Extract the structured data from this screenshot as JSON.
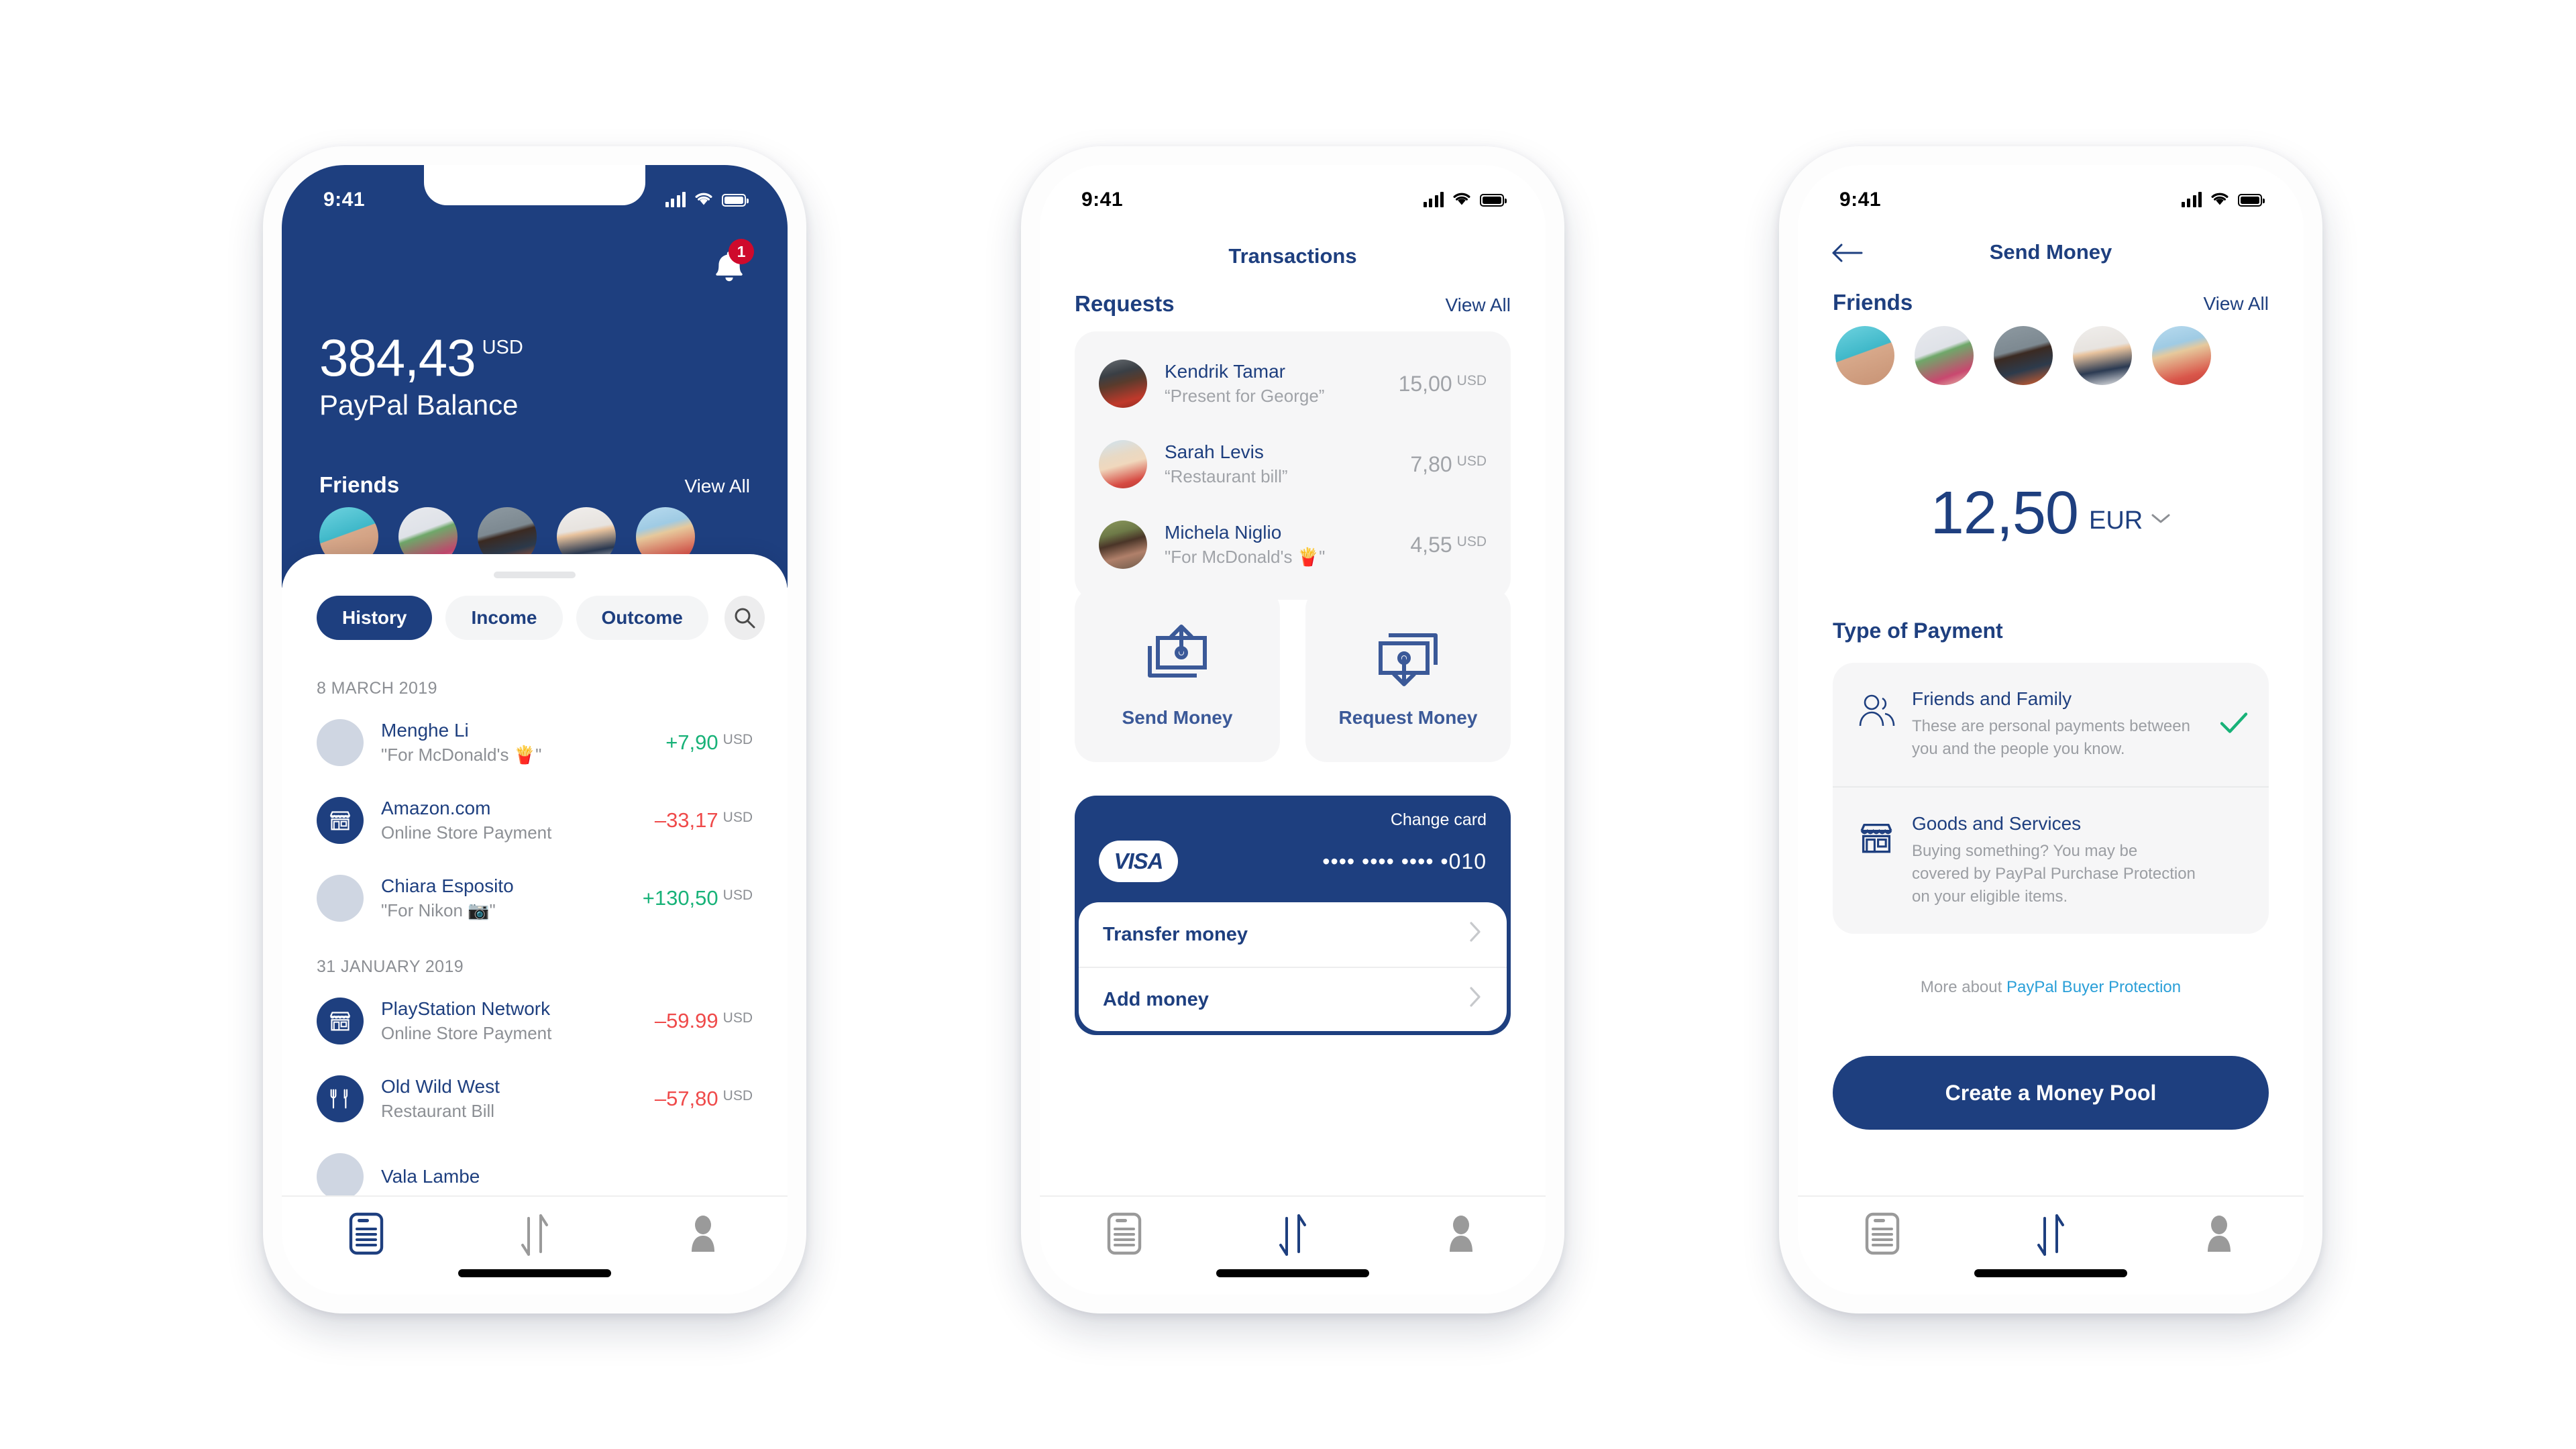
{
  "colors": {
    "brand_blue": "#1e3f7f",
    "accent_blue": "#3b5998",
    "link_blue": "#2a9fd8",
    "positive_green": "#18b278",
    "negative_red": "#ef4a4a",
    "badge_red": "#cf0a2c",
    "muted_gray": "#8c8f94",
    "panel_gray": "#f6f6f7"
  },
  "status_bar": {
    "time": "9:41",
    "signal_icon": "cellular-bars-icon",
    "wifi_icon": "wifi-icon",
    "battery_icon": "battery-full-icon"
  },
  "screen_home": {
    "notification": {
      "icon": "bell-icon",
      "badge_count": "1"
    },
    "balance": {
      "amount": "384,43",
      "currency": "USD",
      "label": "PayPal Balance"
    },
    "friends": {
      "title": "Friends",
      "view_all": "View All",
      "avatars": [
        {
          "name": "friend-avatar-1",
          "style": "av-sky"
        },
        {
          "name": "friend-avatar-2",
          "style": "av-punk"
        },
        {
          "name": "friend-avatar-3",
          "style": "av-man"
        },
        {
          "name": "friend-avatar-4",
          "style": "av-sung"
        },
        {
          "name": "friend-avatar-5",
          "style": "av-blond"
        }
      ]
    },
    "filter_tabs": [
      {
        "label": "History",
        "active": true
      },
      {
        "label": "Income",
        "active": false
      },
      {
        "label": "Outcome",
        "active": false
      }
    ],
    "search_icon": "search-icon",
    "groups": [
      {
        "date": "8 MARCH 2019",
        "rows": [
          {
            "name": "Menghe Li",
            "note": "\"For McDonald's 🍟\"",
            "amount": "+7,90",
            "currency": "USD",
            "sign": "pos",
            "icon": "avatar-photo",
            "avatar_style": "av-sky"
          },
          {
            "name": "Amazon.com",
            "note": "Online Store Payment",
            "amount": "–33,17",
            "currency": "USD",
            "sign": "neg",
            "icon": "store-icon"
          },
          {
            "name": "Chiara Esposito",
            "note": "\"For Nikon 📷\"",
            "amount": "+130,50",
            "currency": "USD",
            "sign": "pos",
            "icon": "avatar-photo",
            "avatar_style": "av-girl"
          }
        ]
      },
      {
        "date": "31 JANUARY 2019",
        "rows": [
          {
            "name": "PlayStation Network",
            "note": "Online Store Payment",
            "amount": "–59.99",
            "currency": "USD",
            "sign": "neg",
            "icon": "store-icon"
          },
          {
            "name": "Old Wild West",
            "note": "Restaurant Bill",
            "amount": "–57,80",
            "currency": "USD",
            "sign": "neg",
            "icon": "restaurant-icon"
          },
          {
            "name": "Vala Lambe",
            "note": "",
            "amount": "",
            "currency": "",
            "sign": "pos",
            "icon": "avatar-photo",
            "avatar_style": "av-vala"
          }
        ]
      }
    ],
    "bottom_nav": [
      {
        "name": "nav-statement",
        "icon": "statement-icon",
        "active": true
      },
      {
        "name": "nav-transfer",
        "icon": "transfer-arrows-icon",
        "active": false
      },
      {
        "name": "nav-profile",
        "icon": "person-icon",
        "active": false
      }
    ]
  },
  "screen_transactions": {
    "title": "Transactions",
    "requests": {
      "title": "Requests",
      "view_all": "View All",
      "rows": [
        {
          "name": "Kendrik Tamar",
          "note": "“Present for George”",
          "amount": "15,00",
          "currency": "USD",
          "avatar_style": "av-dark"
        },
        {
          "name": "Sarah Levis",
          "note": "“Restaurant bill”",
          "amount": "7,80",
          "currency": "USD",
          "avatar_style": "av-sarah"
        },
        {
          "name": "Michela Niglio",
          "note": "\"For McDonald's 🍟\"",
          "amount": "4,55",
          "currency": "USD",
          "avatar_style": "av-mich"
        }
      ]
    },
    "actions": [
      {
        "label": "Send Money",
        "icon": "send-money-icon"
      },
      {
        "label": "Request Money",
        "icon": "request-money-icon"
      }
    ],
    "card": {
      "change_card": "Change card",
      "brand": "VISA",
      "number_masked": "•••• •••• •••• •010",
      "items": [
        {
          "label": "Transfer money",
          "chevron": "chevron-right-icon"
        },
        {
          "label": "Add money",
          "chevron": "chevron-right-icon"
        }
      ]
    },
    "bottom_nav": [
      {
        "name": "nav-statement",
        "icon": "statement-icon",
        "active": false
      },
      {
        "name": "nav-transfer",
        "icon": "transfer-arrows-icon",
        "active": true
      },
      {
        "name": "nav-profile",
        "icon": "person-icon",
        "active": false
      }
    ]
  },
  "screen_send_money": {
    "back_icon": "arrow-left-icon",
    "title": "Send Money",
    "friends": {
      "title": "Friends",
      "view_all": "View All",
      "avatars": [
        {
          "name": "friend-avatar-1",
          "style": "av-sky"
        },
        {
          "name": "friend-avatar-2",
          "style": "av-punk"
        },
        {
          "name": "friend-avatar-3",
          "style": "av-man"
        },
        {
          "name": "friend-avatar-4",
          "style": "av-sung"
        },
        {
          "name": "friend-avatar-5",
          "style": "av-blond"
        }
      ]
    },
    "amount": {
      "value": "12,50",
      "currency": "EUR",
      "chevron": "chevron-down-icon"
    },
    "payment_type": {
      "title": "Type of Payment",
      "options": [
        {
          "name": "Friends and Family",
          "description": "These are personal payments between you and the people you know.",
          "icon": "people-icon",
          "selected": true,
          "check_icon": "check-icon"
        },
        {
          "name": "Goods and Services",
          "description": "Buying something? You may be covered by PayPal Purchase Protection on your eligible items.",
          "icon": "store-icon",
          "selected": false
        }
      ]
    },
    "more_text": "More about ",
    "more_link": "PayPal Buyer Protection",
    "cta_label": "Create a Money Pool",
    "bottom_nav": [
      {
        "name": "nav-statement",
        "icon": "statement-icon",
        "active": false
      },
      {
        "name": "nav-transfer",
        "icon": "transfer-arrows-icon",
        "active": true
      },
      {
        "name": "nav-profile",
        "icon": "person-icon",
        "active": false
      }
    ]
  }
}
